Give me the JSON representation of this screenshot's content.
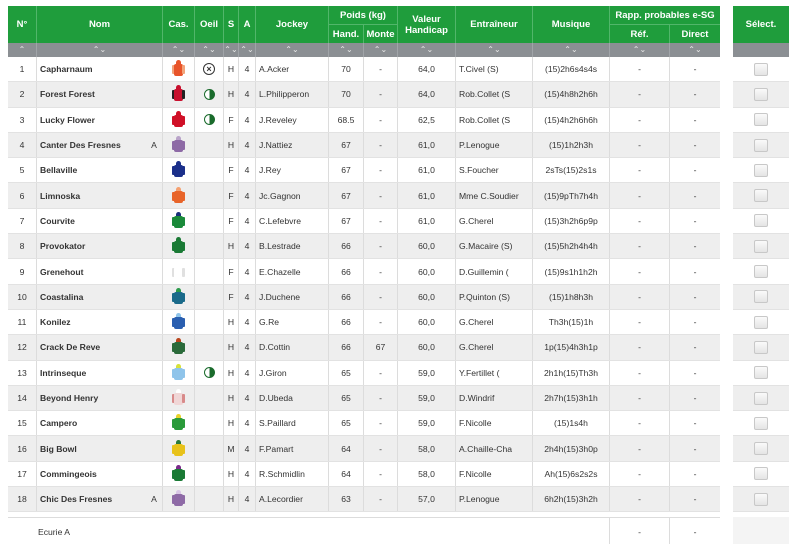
{
  "headers": {
    "num": "N°",
    "nom": "Nom",
    "cas": "Cas.",
    "oeil": "Oeil",
    "s": "S",
    "a": "A",
    "jockey": "Jockey",
    "poids": "Poids (kg)",
    "hand": "Hand.",
    "monte": "Monte",
    "valeur": "Valeur Handicap",
    "entraineur": "Entraîneur",
    "musique": "Musique",
    "rapp": "Rapp. probables e-SG",
    "ref": "Réf.",
    "direct": "Direct",
    "select": "Sélect."
  },
  "sort_glyph": "⌃⌄",
  "sort_up": "⌃",
  "colors": {
    "header_green": "#1f9d3c",
    "sortbar_gray": "#8b8f93"
  },
  "rows": [
    {
      "num": "1",
      "nom": "Capharnaum",
      "flag": "",
      "eye": "x",
      "s": "H",
      "a": "4",
      "jockey": "A.Acker",
      "hand": "70",
      "monte": "-",
      "valeur": "64,0",
      "entraineur": "T.Civel (S)",
      "musique": "(15)2h6s4s4s",
      "ref": "-",
      "direct": "-",
      "silk": [
        "#e8542a",
        "#e8542a",
        "#f3a37a"
      ]
    },
    {
      "num": "2",
      "nom": "Forest Forest",
      "flag": "",
      "eye": "half",
      "s": "H",
      "a": "4",
      "jockey": "L.Philipperon",
      "hand": "70",
      "monte": "-",
      "valeur": "64,0",
      "entraineur": "Rob.Collet (S",
      "musique": "(15)4h8h2h6h",
      "ref": "-",
      "direct": "-",
      "silk": [
        "#c8102e",
        "#c8102e",
        "#222222"
      ]
    },
    {
      "num": "3",
      "nom": "Lucky Flower",
      "flag": "",
      "eye": "half",
      "s": "F",
      "a": "4",
      "jockey": "J.Reveley",
      "hand": "68.5",
      "monte": "-",
      "valeur": "62,5",
      "entraineur": "Rob.Collet (S",
      "musique": "(15)4h2h6h6h",
      "ref": "-",
      "direct": "-",
      "silk": [
        "#d01027",
        "#d01027",
        "#d01027"
      ]
    },
    {
      "num": "4",
      "nom": "Canter Des Fresnes",
      "flag": "A",
      "eye": "",
      "s": "H",
      "a": "4",
      "jockey": "J.Nattiez",
      "hand": "67",
      "monte": "-",
      "valeur": "61,0",
      "entraineur": "P.Lenogue",
      "musique": "(15)1h2h3h",
      "ref": "-",
      "direct": "-",
      "silk": [
        "#8e6aa6",
        "#b9a3c9",
        "#8e6aa6"
      ]
    },
    {
      "num": "5",
      "nom": "Bellaville",
      "flag": "",
      "eye": "",
      "s": "F",
      "a": "4",
      "jockey": "J.Rey",
      "hand": "67",
      "monte": "-",
      "valeur": "61,0",
      "entraineur": "S.Foucher",
      "musique": "2sTs(15)2s1s",
      "ref": "-",
      "direct": "-",
      "silk": [
        "#1b2f8a",
        "#1b2f8a",
        "#1b2f8a"
      ]
    },
    {
      "num": "6",
      "nom": "Limnoska",
      "flag": "",
      "eye": "",
      "s": "F",
      "a": "4",
      "jockey": "Jc.Gagnon",
      "hand": "67",
      "monte": "-",
      "valeur": "61,0",
      "entraineur": "Mme C.Soudier",
      "musique": "(15)9pTh7h4h",
      "ref": "-",
      "direct": "-",
      "silk": [
        "#e8642a",
        "#f5a070",
        "#e8642a"
      ]
    },
    {
      "num": "7",
      "nom": "Courvite",
      "flag": "",
      "eye": "",
      "s": "F",
      "a": "4",
      "jockey": "C.Lefebvre",
      "hand": "67",
      "monte": "-",
      "valeur": "61,0",
      "entraineur": "G.Cherel",
      "musique": "(15)3h2h6p9p",
      "ref": "-",
      "direct": "-",
      "silk": [
        "#1a8a3a",
        "#1a2f7a",
        "#1a8a3a"
      ]
    },
    {
      "num": "8",
      "nom": "Provokator",
      "flag": "",
      "eye": "",
      "s": "H",
      "a": "4",
      "jockey": "B.Lestrade",
      "hand": "66",
      "monte": "-",
      "valeur": "60,0",
      "entraineur": "G.Macaire (S)",
      "musique": "(15)5h2h4h4h",
      "ref": "-",
      "direct": "-",
      "silk": [
        "#1a7a35",
        "#1a7a35",
        "#1a7a35"
      ]
    },
    {
      "num": "9",
      "nom": "Grenehout",
      "flag": "",
      "eye": "",
      "s": "F",
      "a": "4",
      "jockey": "E.Chazelle",
      "hand": "66",
      "monte": "-",
      "valeur": "60,0",
      "entraineur": "D.Guillemin (",
      "musique": "(15)9s1h1h2h",
      "ref": "-",
      "direct": "-",
      "silk": [
        "#ffffff",
        "#ffffff",
        "#e0e0e0"
      ]
    },
    {
      "num": "10",
      "nom": "Coastalina",
      "flag": "",
      "eye": "",
      "s": "F",
      "a": "4",
      "jockey": "J.Duchene",
      "hand": "66",
      "monte": "-",
      "valeur": "60,0",
      "entraineur": "P.Quinton (S)",
      "musique": "(15)1h8h3h",
      "ref": "-",
      "direct": "-",
      "silk": [
        "#1a6a8a",
        "#2a9a4a",
        "#1a6a8a"
      ]
    },
    {
      "num": "11",
      "nom": "Konilez",
      "flag": "",
      "eye": "",
      "s": "H",
      "a": "4",
      "jockey": "G.Re",
      "hand": "66",
      "monte": "-",
      "valeur": "60,0",
      "entraineur": "G.Cherel",
      "musique": "Th3h(15)1h",
      "ref": "-",
      "direct": "-",
      "silk": [
        "#2a5fb0",
        "#8fc4ea",
        "#2a5fb0"
      ]
    },
    {
      "num": "12",
      "nom": "Crack De Reve",
      "flag": "",
      "eye": "",
      "s": "H",
      "a": "4",
      "jockey": "D.Cottin",
      "hand": "66",
      "monte": "67",
      "valeur": "60,0",
      "entraineur": "G.Cherel",
      "musique": "1p(15)4h3h1p",
      "ref": "-",
      "direct": "-",
      "silk": [
        "#2a6a3a",
        "#b8441a",
        "#2a6a3a"
      ]
    },
    {
      "num": "13",
      "nom": "Intrinseque",
      "flag": "",
      "eye": "half",
      "s": "H",
      "a": "4",
      "jockey": "J.Giron",
      "hand": "65",
      "monte": "-",
      "valeur": "59,0",
      "entraineur": "Y.Fertillet (",
      "musique": "2h1h(15)Th3h",
      "ref": "-",
      "direct": "-",
      "silk": [
        "#8fc4ea",
        "#d6e23a",
        "#8fc4ea"
      ]
    },
    {
      "num": "14",
      "nom": "Beyond Henry",
      "flag": "",
      "eye": "",
      "s": "H",
      "a": "4",
      "jockey": "D.Ubeda",
      "hand": "65",
      "monte": "-",
      "valeur": "59,0",
      "entraineur": "D.Windrif",
      "musique": "2h7h(15)3h1h",
      "ref": "-",
      "direct": "-",
      "silk": [
        "#f0d6d6",
        "#ffffff",
        "#d88a8a"
      ]
    },
    {
      "num": "15",
      "nom": "Campero",
      "flag": "",
      "eye": "",
      "s": "H",
      "a": "4",
      "jockey": "S.Paillard",
      "hand": "65",
      "monte": "-",
      "valeur": "59,0",
      "entraineur": "F.Nicolle",
      "musique": "(15)1s4h",
      "ref": "-",
      "direct": "-",
      "silk": [
        "#2a9a3a",
        "#e8d22a",
        "#2a9a3a"
      ]
    },
    {
      "num": "16",
      "nom": "Big Bowl",
      "flag": "",
      "eye": "",
      "s": "M",
      "a": "4",
      "jockey": "F.Pamart",
      "hand": "64",
      "monte": "-",
      "valeur": "58,0",
      "entraineur": "A.Chaille-Cha",
      "musique": "2h4h(15)3h0p",
      "ref": "-",
      "direct": "-",
      "silk": [
        "#e8c21a",
        "#2a7a3a",
        "#e8c21a"
      ]
    },
    {
      "num": "17",
      "nom": "Commingeois",
      "flag": "",
      "eye": "",
      "s": "H",
      "a": "4",
      "jockey": "R.Schmidlin",
      "hand": "64",
      "monte": "-",
      "valeur": "58,0",
      "entraineur": "F.Nicolle",
      "musique": "Ah(15)6s2s2s",
      "ref": "-",
      "direct": "-",
      "silk": [
        "#1a7a35",
        "#7a2a8a",
        "#1a7a35"
      ]
    },
    {
      "num": "18",
      "nom": "Chic Des Fresnes",
      "flag": "A",
      "eye": "",
      "s": "H",
      "a": "4",
      "jockey": "A.Lecordier",
      "hand": "63",
      "monte": "-",
      "valeur": "57,0",
      "entraineur": "P.Lenogue",
      "musique": "6h2h(15)3h2h",
      "ref": "-",
      "direct": "-",
      "silk": [
        "#8e6aa6",
        "#d9c6e6",
        "#8e6aa6"
      ]
    }
  ],
  "footer": {
    "label": "Ecurie A",
    "ref": "-",
    "direct": "-"
  }
}
